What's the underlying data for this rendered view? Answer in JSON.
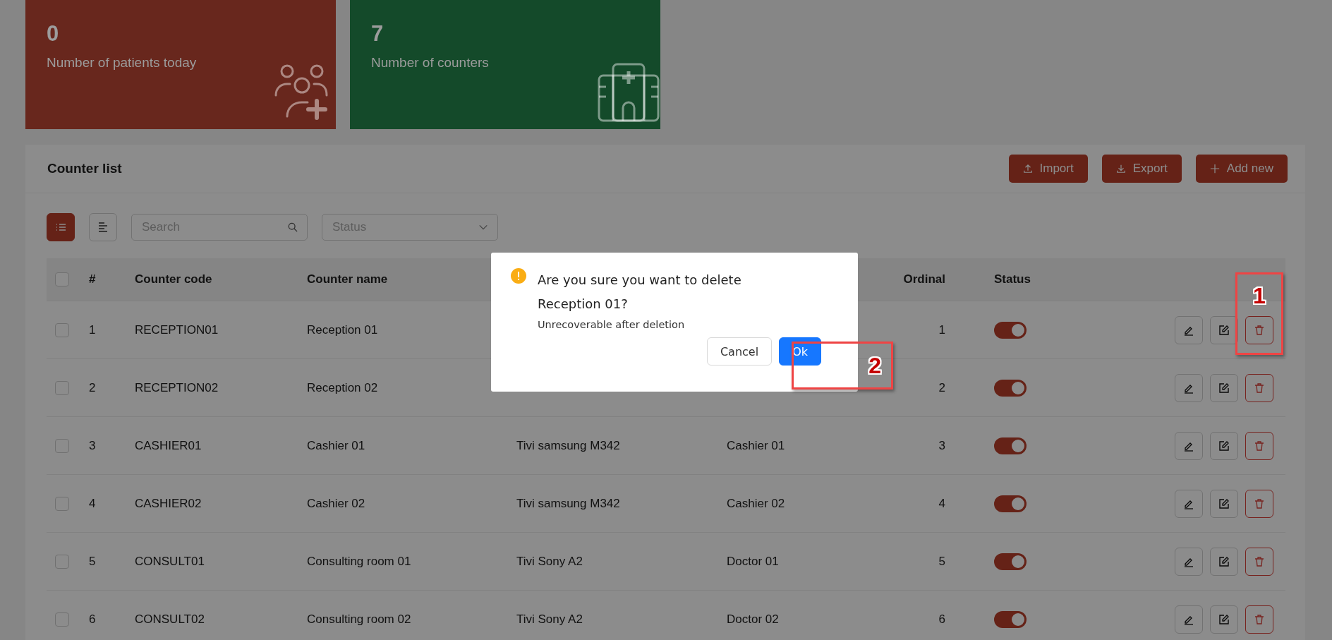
{
  "stats": [
    {
      "value": "0",
      "label": "Number of patients today",
      "color": "#68271d",
      "kind": "patients"
    },
    {
      "value": "7",
      "label": "Number of counters",
      "color": "#144a2a",
      "kind": "hospital"
    }
  ],
  "panel": {
    "title": "Counter list",
    "actions": [
      {
        "label": "Import",
        "kind": "import"
      },
      {
        "label": "Export",
        "kind": "export"
      },
      {
        "label": "Add new",
        "kind": "add"
      }
    ]
  },
  "toolbar": {
    "views": [
      {
        "kind": "list",
        "selected": true
      },
      {
        "kind": "align",
        "selected": false
      }
    ],
    "search": {
      "placeholder": "Search"
    },
    "status_filter": {
      "placeholder": "Status"
    }
  },
  "table": {
    "select_all": {
      "checked": false
    },
    "columns": {
      "index": "#",
      "code": "Counter code",
      "name": "Counter name",
      "ordinal": "Ordinal",
      "status": "Status"
    },
    "rows": [
      {
        "checked": false,
        "index": "1",
        "code": "RECEPTION01",
        "name": "Reception 01",
        "ordinal": "1",
        "on": true
      },
      {
        "checked": false,
        "index": "2",
        "code": "RECEPTION02",
        "name": "Reception 02",
        "ordinal": "2",
        "on": true
      },
      {
        "checked": false,
        "index": "3",
        "code": "CASHIER01",
        "name": "Cashier 01",
        "device": "Tivi samsung M342",
        "display": "Cashier 01",
        "ordinal": "3",
        "on": true
      },
      {
        "checked": false,
        "index": "4",
        "code": "CASHIER02",
        "name": "Cashier 02",
        "device": "Tivi samsung M342",
        "display": "Cashier 02",
        "ordinal": "4",
        "on": true
      },
      {
        "checked": false,
        "index": "5",
        "code": "CONSULT01",
        "name": "Consulting room 01",
        "device": "Tivi Sony A2",
        "display": "Doctor 01",
        "ordinal": "5",
        "on": true
      },
      {
        "checked": false,
        "index": "6",
        "code": "CONSULT02",
        "name": "Consulting room 02",
        "device": "Tivi Sony A2",
        "display": "Doctor 02",
        "ordinal": "6",
        "on": true
      }
    ]
  },
  "dialog": {
    "title": "Are you sure you want to delete Reception 01?",
    "message": "Unrecoverable after deletion",
    "buttons": [
      {
        "label": "Cancel",
        "kind": "default"
      },
      {
        "label": "Ok",
        "kind": "primary"
      }
    ]
  },
  "annotations": [
    {
      "label": "1"
    },
    {
      "label": "2"
    }
  ]
}
